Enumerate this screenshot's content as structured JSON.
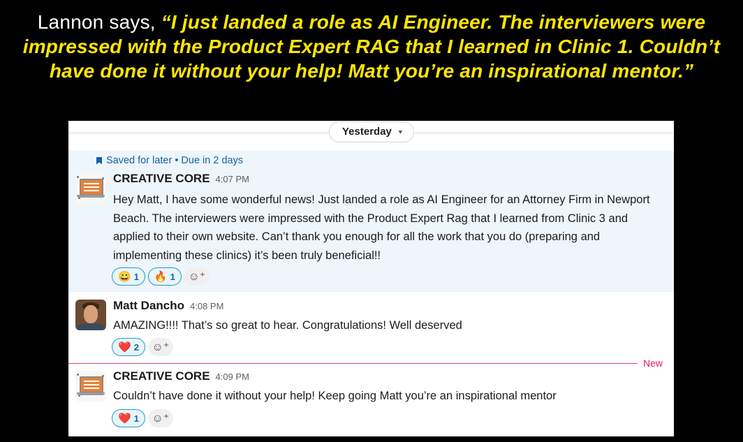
{
  "caption": {
    "lead": "Lannon says, ",
    "quote": "“I just landed a role as AI Engineer. The interviewers were impressed with the Product Expert RAG that I learned in Clinic 1. Couldn’t have done it without your help! Matt you’re an inspirational mentor.”"
  },
  "divider": {
    "label": "Yesterday",
    "chevron": "⌄"
  },
  "saved": {
    "text": "Saved for later • Due in 2 days",
    "icon": "bookmark-icon"
  },
  "messages": [
    {
      "author": "CREATIVE CORE",
      "time": "4:07 PM",
      "avatar": "laptop-logo-avatar",
      "text": "Hey Matt, I have some wonderful news! Just landed a role as AI Engineer for an Attorney Firm in Newport Beach. The interviewers were impressed with the Product Expert Rag that I learned from Clinic 3 and applied to their own website. Can’t thank you enough for all the work that you do (preparing and implementing these clinics) it’s been truly beneficial!!",
      "reactions": [
        {
          "emoji": "😀",
          "count": "1"
        },
        {
          "emoji": "🔥",
          "count": "1"
        }
      ]
    },
    {
      "author": "Matt Dancho",
      "time": "4:08 PM",
      "avatar": "person-photo-avatar",
      "text": "AMAZING!!!! That’s so great to hear. Congratulations! Well deserved",
      "reactions": [
        {
          "emoji": "❤️",
          "count": "2"
        }
      ]
    },
    {
      "author": "CREATIVE CORE",
      "time": "4:09 PM",
      "avatar": "laptop-logo-avatar",
      "text": "Couldn’t have done it without your help! Keep going Matt you’re an inspirational mentor",
      "reactions": [
        {
          "emoji": "❤️",
          "count": "1"
        }
      ]
    }
  ],
  "new_divider": {
    "label": "New"
  },
  "add_reaction_icon": "☺⁺",
  "colors": {
    "caption_quote": "#ffe600",
    "highlight_bg": "#eef5fb",
    "link_blue": "#1264a3",
    "new_red": "#e01e5a"
  }
}
